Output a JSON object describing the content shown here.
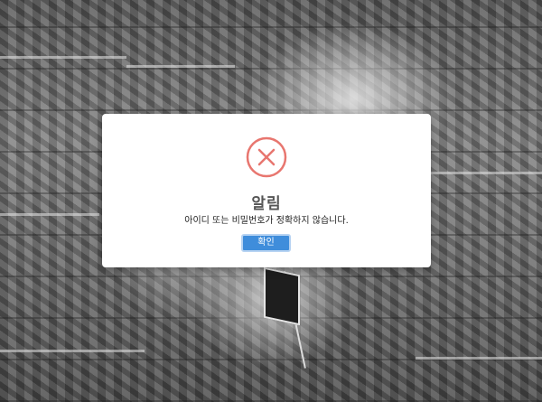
{
  "dialog": {
    "icon": "error-x-circle-icon",
    "icon_color": "#e8766f",
    "title": "알림",
    "message": "아이디 또는 비밀번호가 정확하지 않습니다.",
    "confirm_label": "확인",
    "button_color": "#3f8ddb"
  }
}
